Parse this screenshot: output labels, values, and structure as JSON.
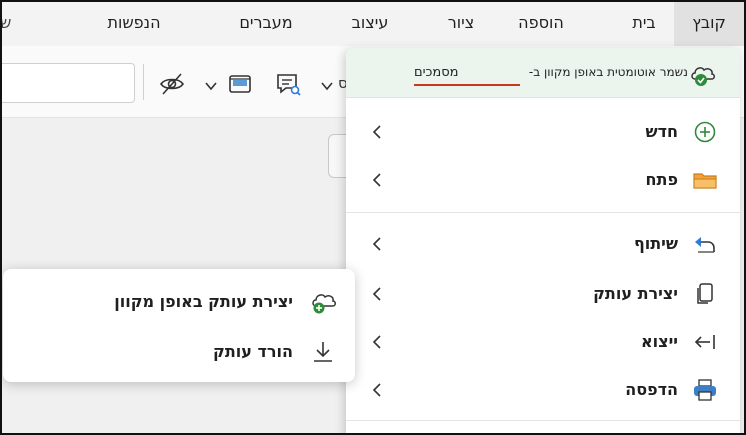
{
  "ribbon": {
    "tabs": [
      {
        "label": "קובץ",
        "active": true
      },
      {
        "label": "בית",
        "active": false
      },
      {
        "label": "הוספה",
        "active": false
      },
      {
        "label": "ציור",
        "active": false
      },
      {
        "label": "עיצוב",
        "active": false
      },
      {
        "label": "מעברים",
        "active": false
      },
      {
        "label": "הנפשות",
        "active": false
      },
      {
        "label": "ש",
        "active": false
      }
    ]
  },
  "toolbar": {
    "icons": [
      "hide-eye-icon",
      "display-settings-icon",
      "comment-search-icon"
    ],
    "partial_label": "ס"
  },
  "file_menu": {
    "autosave": {
      "text": "נשמר אוטומטית באופן מקוון ב-",
      "location": "מסמכים",
      "icon": "cloud-check-icon",
      "accent": "#c43d1a",
      "background": "#ebf5ee"
    },
    "items": [
      {
        "label": "חדש",
        "icon": "add-circle-icon"
      },
      {
        "label": "פתח",
        "icon": "folder-icon"
      },
      {
        "label": "שיתוף",
        "icon": "share-icon"
      },
      {
        "label": "יצירת עותק",
        "icon": "copy-icon"
      },
      {
        "label": "ייצוא",
        "icon": "export-icon"
      },
      {
        "label": "הדפסה",
        "icon": "printer-icon"
      }
    ]
  },
  "copy_submenu": {
    "items": [
      {
        "label": "יצירת עותק באופן מקוון",
        "icon": "cloud-add-icon"
      },
      {
        "label": "הורד עותק",
        "icon": "download-icon"
      }
    ]
  },
  "colors": {
    "active_tab": "#e1e1e1",
    "green": "#2e8b3a",
    "folder": "#f2a33a",
    "printer": "#3d7fc4"
  }
}
